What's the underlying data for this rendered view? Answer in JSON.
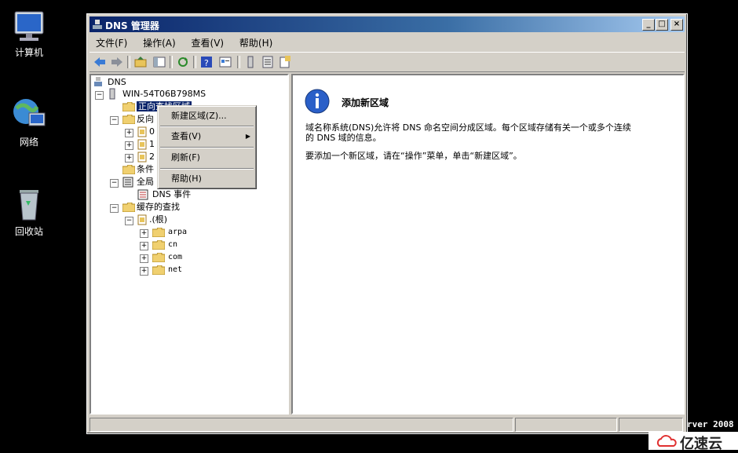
{
  "desktop": {
    "icons": [
      {
        "label": "计算机"
      },
      {
        "label": "网络"
      },
      {
        "label": "回收站"
      }
    ]
  },
  "window": {
    "title": "DNS 管理器",
    "controls": {
      "minimize": "_",
      "maximize": "□",
      "close": "×"
    }
  },
  "menubar": [
    "文件(F)",
    "操作(A)",
    "查看(V)",
    "帮助(H)"
  ],
  "tree": {
    "root": "DNS",
    "server": "WIN-54T06B798MS",
    "forward_zone": "正向查找区域",
    "reverse_zone": "反向",
    "conditional": "条件",
    "global_logs": "全局",
    "dns_events": "DNS 事件",
    "cached_lookups": "缓存的查找",
    "root_hint": ".(根)",
    "cache_children": [
      "arpa",
      "cn",
      "com",
      "net"
    ],
    "reverse_children": [
      "0",
      "1",
      "2"
    ]
  },
  "context_menu": {
    "items": [
      "新建区域(Z)...",
      "查看(V)",
      "刷新(F)",
      "帮助(H)"
    ],
    "submenu_arrow": "▶"
  },
  "right_pane": {
    "title": "添加新区域",
    "para1_line1": "域名称系统(DNS)允许将 DNS 命名空间分成区域。每个区域存储有关一个或多个连续",
    "para1_line2": "的 DNS 域的信息。",
    "para2": "要添加一个新区域，请在“操作”菜单，单击“新建区域”。"
  },
  "desktop_text": "rver 2008",
  "watermark": "亿速云",
  "colors": {
    "title_start": "#0a246a",
    "title_end": "#a6caf0",
    "selection": "#0a246a",
    "face": "#d4d0c8"
  }
}
